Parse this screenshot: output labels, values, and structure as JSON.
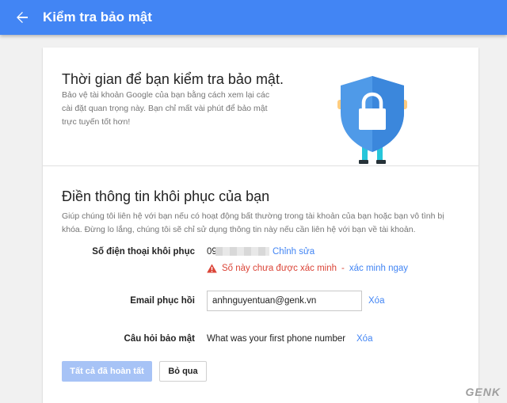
{
  "appbar": {
    "title": "Kiểm tra bảo mật"
  },
  "hero": {
    "title": "Thời gian để bạn kiểm tra bảo mật.",
    "description": "Bảo vệ tài khoản Google của bạn bằng cách xem lại các cài đặt quan trọng này. Bạn chỉ mất vài phút để bảo mật trực tuyến tốt hơn!"
  },
  "recovery": {
    "title": "Điền thông tin khôi phục của bạn",
    "description": "Giúp chúng tôi liên hệ với bạn nếu có hoạt động bất thường trong tài khoản của bạn hoặc bạn vô tình bị khóa. Đừng lo lắng, chúng tôi sẽ chỉ sử dụng thông tin này nếu cần liên hệ với bạn về tài khoản.",
    "phone": {
      "label": "Số điện thoại khôi phục",
      "value_prefix": "09",
      "edit_label": "Chỉnh sửa",
      "warning": "Số này chưa được xác minh",
      "separator": "-",
      "verify_label": "xác minh ngay"
    },
    "email": {
      "label": "Email phục hồi",
      "value": "anhnguyentuan@genk.vn",
      "remove_label": "Xóa"
    },
    "question": {
      "label": "Câu hỏi bảo mật",
      "value": "What was your first phone number",
      "remove_label": "Xóa"
    }
  },
  "actions": {
    "done_label": "Tất cả đã hoàn tất",
    "skip_label": "Bỏ qua"
  },
  "watermark": "GENK",
  "colors": {
    "accent": "#4285f4",
    "warning": "#db4437",
    "shield": "#4f9ae8"
  },
  "icons": {
    "back": "arrow-back-icon",
    "shield": "shield-lock-illustration",
    "warning": "warning-triangle-icon"
  }
}
